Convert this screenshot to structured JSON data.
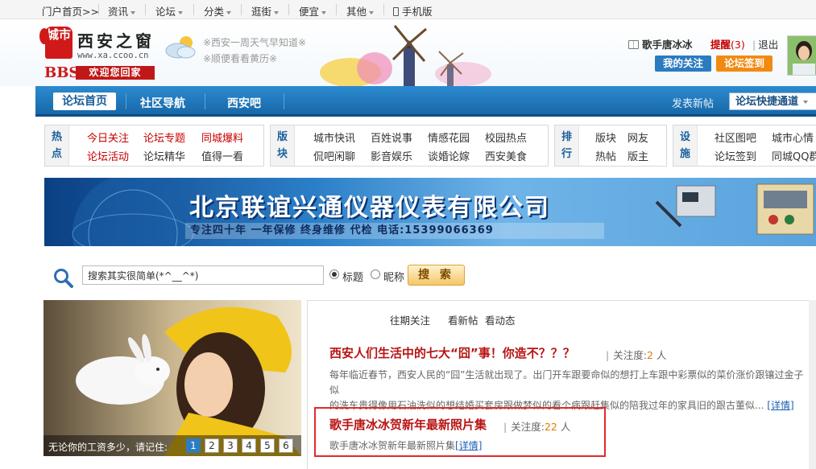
{
  "topnav": {
    "home": "门户首页>>",
    "items": [
      {
        "label": "资讯"
      },
      {
        "label": "论坛"
      },
      {
        "label": "分类"
      },
      {
        "label": "逛街"
      },
      {
        "label": "便宜"
      },
      {
        "label": "其他"
      }
    ],
    "mobile": "手机版"
  },
  "header": {
    "logo_badge": "城市",
    "logo_title": "西安之窗",
    "logo_url": "www.xa.ccoo.cn",
    "logo_bbs": "BBS",
    "logo_welcome": "欢迎您回家",
    "weather_line1": "※西安一周天气早知道※",
    "weather_line2": "※顺便看看黄历※",
    "user_name": "歌手唐冰冰",
    "remind_label": "提醒",
    "remind_count": "(3)",
    "logout": "退出",
    "follow_button": "我的关注",
    "sign_button": "论坛签到"
  },
  "mainnav": {
    "active": "论坛首页",
    "items": [
      "社区导航",
      "西安吧"
    ],
    "post_link": "发表新帖",
    "quick_select": "论坛快捷通道"
  },
  "link_groups": [
    {
      "label_top": "热",
      "label_bottom": "点",
      "row1": [
        "今日关注",
        "论坛专题",
        "同城爆料"
      ],
      "row2": [
        "论坛活动",
        "论坛精华",
        "值得一看"
      ]
    },
    {
      "label_top": "版",
      "label_bottom": "块",
      "row1": [
        "城市快讯",
        "百姓说事",
        "情感花园",
        "校园热点"
      ],
      "row2": [
        "侃吧闲聊",
        "影音娱乐",
        "谈婚论嫁",
        "西安美食"
      ]
    },
    {
      "label_top": "排",
      "label_bottom": "行",
      "row1": [
        "版块",
        "网友"
      ],
      "row2": [
        "热帖",
        "版主"
      ]
    },
    {
      "label_top": "设",
      "label_bottom": "施",
      "row1": [
        "社区图吧",
        "城市心情"
      ],
      "row2": [
        "论坛签到",
        "同城QQ群"
      ]
    }
  ],
  "banner": {
    "title": "北京联谊兴通仪器仪表有限公司",
    "subtitle": "专注四十年 一年保修 终身维修 代检 电话:15399066369"
  },
  "search": {
    "value": "搜索其实很简单(*^__^*)",
    "option_title": "标题",
    "option_nick": "昵称",
    "button": "搜 索"
  },
  "photo": {
    "caption": "无论你的工资多少，请记住:",
    "pages": [
      "1",
      "2",
      "3",
      "4",
      "5",
      "6"
    ],
    "active_page": "1"
  },
  "right": {
    "tabs": [
      "往期关注",
      "看新帖",
      "看动态"
    ],
    "articles": [
      {
        "title": "西安人们生活中的七大“囧”事！你造不？？？",
        "meta_label": "关注度:",
        "meta_count": "2",
        "meta_unit": "人",
        "desc_line1": "每年临近春节，西安人民的“囧”生活就出现了。出门开车跟要命似的想打上车跟中彩票似的菜价涨价跟镶过金子似",
        "desc_line2": "的洗车贵得像用石油洗似的想结婚买套房跟做梦似的看个病跟赶集似的陪我过年的家具旧的跟古董似...",
        "detail": "[详情]"
      },
      {
        "title": "歌手唐冰冰贺新年最新照片集",
        "meta_label": "关注度:",
        "meta_count": "22",
        "meta_unit": "人",
        "desc_line1": "歌手唐冰冰贺新年最新照片集",
        "detail": "[详情]"
      }
    ]
  },
  "colors": {
    "nav_blue": "#1868a8",
    "headline_red": "#b81414",
    "highlight_border": "#e0292c",
    "sign_orange": "#f28a12"
  }
}
